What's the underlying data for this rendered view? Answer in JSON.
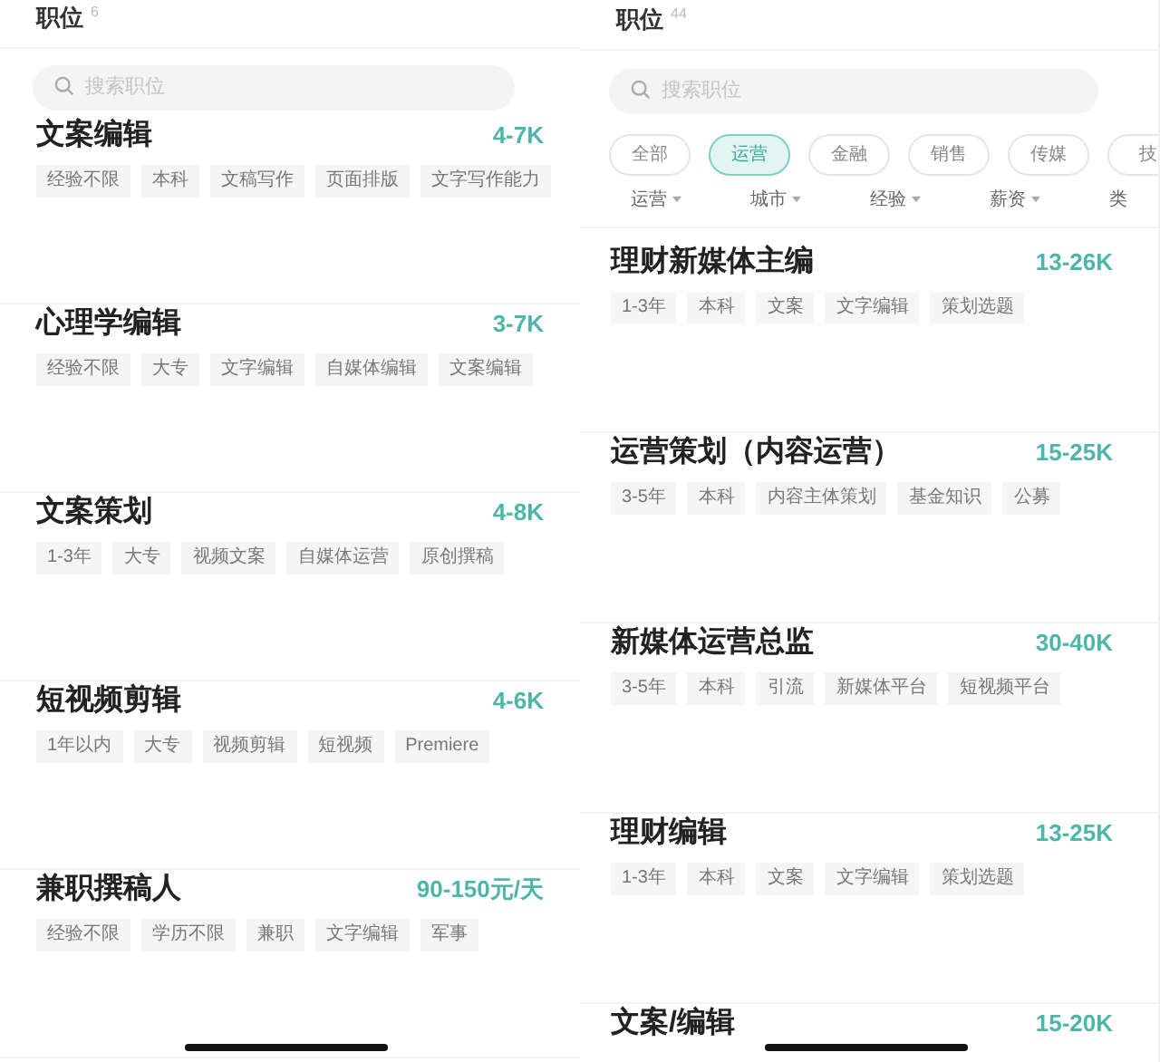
{
  "panels": [
    {
      "title": "职位",
      "count": "6",
      "search": {
        "placeholder": "搜索职位"
      },
      "jobs": [
        {
          "title": "文案编辑",
          "salary": "4-7K",
          "tags": [
            "经验不限",
            "本科",
            "文稿写作",
            "页面排版",
            "文字写作能力"
          ]
        },
        {
          "title": "心理学编辑",
          "salary": "3-7K",
          "tags": [
            "经验不限",
            "大专",
            "文字编辑",
            "自媒体编辑",
            "文案编辑"
          ]
        },
        {
          "title": "文案策划",
          "salary": "4-8K",
          "tags": [
            "1-3年",
            "大专",
            "视频文案",
            "自媒体运营",
            "原创撰稿"
          ]
        },
        {
          "title": "短视频剪辑",
          "salary": "4-6K",
          "tags": [
            "1年以内",
            "大专",
            "视频剪辑",
            "短视频",
            "Premiere"
          ]
        },
        {
          "title": "兼职撰稿人",
          "salary": "90-150元/天",
          "tags": [
            "经验不限",
            "学历不限",
            "兼职",
            "文字编辑",
            "军事"
          ]
        }
      ]
    },
    {
      "title": "职位",
      "count": "44",
      "search": {
        "placeholder": "搜索职位"
      },
      "categories": [
        {
          "label": "全部",
          "selected": false
        },
        {
          "label": "运营",
          "selected": true
        },
        {
          "label": "金融",
          "selected": false
        },
        {
          "label": "销售",
          "selected": false
        },
        {
          "label": "传媒",
          "selected": false
        },
        {
          "label": "技",
          "selected": false
        }
      ],
      "filters": [
        "运营",
        "城市",
        "经验",
        "薪资",
        "类"
      ],
      "jobs": [
        {
          "title": "理财新媒体主编",
          "salary": "13-26K",
          "tags": [
            "1-3年",
            "本科",
            "文案",
            "文字编辑",
            "策划选题"
          ]
        },
        {
          "title": "运营策划（内容运营）",
          "salary": "15-25K",
          "tags": [
            "3-5年",
            "本科",
            "内容主体策划",
            "基金知识",
            "公募"
          ]
        },
        {
          "title": "新媒体运营总监",
          "salary": "30-40K",
          "tags": [
            "3-5年",
            "本科",
            "引流",
            "新媒体平台",
            "短视频平台"
          ]
        },
        {
          "title": "理财编辑",
          "salary": "13-25K",
          "tags": [
            "1-3年",
            "本科",
            "文案",
            "文字编辑",
            "策划选题"
          ]
        },
        {
          "title": "文案/编辑",
          "salary": "15-20K"
        }
      ]
    }
  ]
}
